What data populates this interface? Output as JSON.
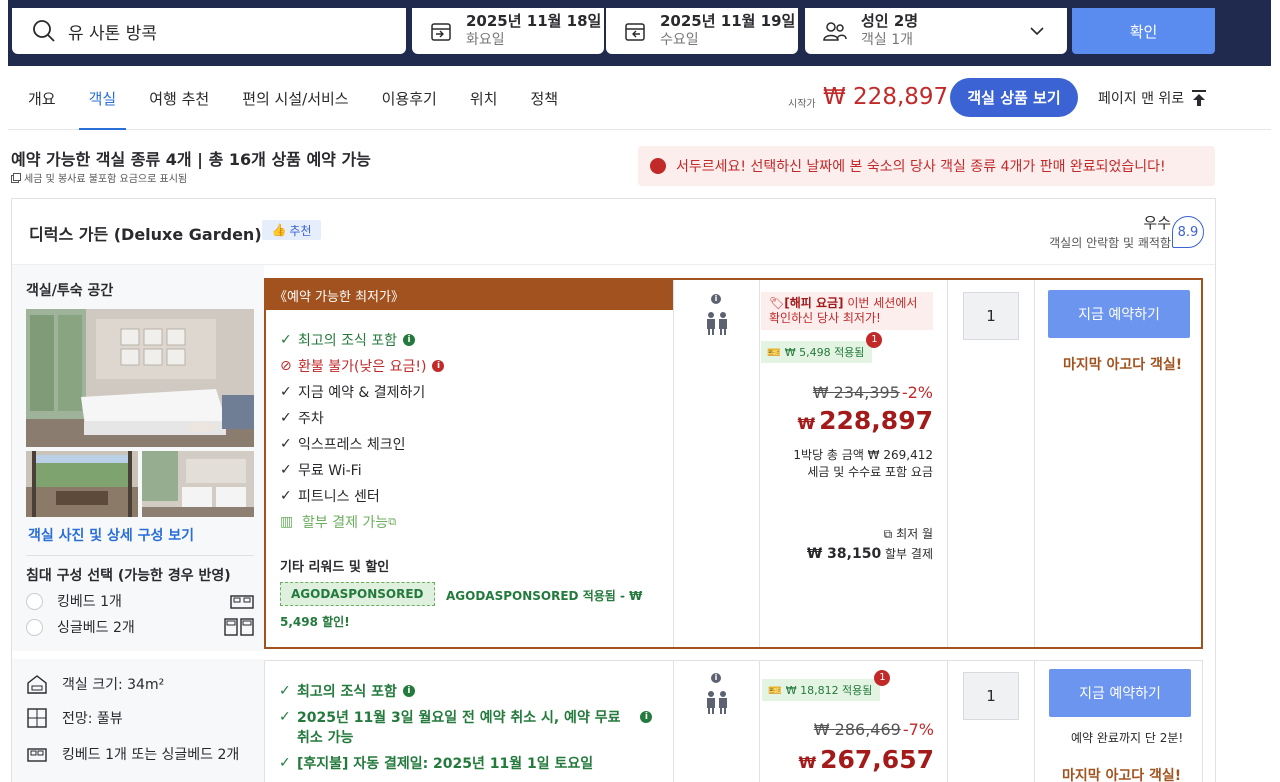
{
  "search": {
    "destination": "유 사톤 방콕",
    "checkin_date": "2025년 11월 18일",
    "checkin_day": "화요일",
    "checkout_date": "2025년 11월 19일",
    "checkout_day": "수요일",
    "guests": "성인 2명",
    "rooms": "객실 1개",
    "confirm_label": "확인"
  },
  "nav": {
    "tabs": [
      "개요",
      "객실",
      "여행 추천",
      "편의 시설/서비스",
      "이용후기",
      "위치",
      "정책"
    ],
    "active_tab": "객실",
    "start_label": "시작가",
    "start_price": "₩ 228,897",
    "rooms_button": "객실 상품 보기",
    "to_top": "페이지 맨 위로"
  },
  "summary": {
    "title": "예약 가능한 객실 종류 4개 | 총 16개 상품 예약 가능",
    "tax_note": "세금 및 봉사료 불포함 요금으로 표시됨",
    "alert": "서두르세요! 선택하신 날짜에 본 숙소의 당사 객실 종류 4개가 판매 완료되었습니다!"
  },
  "room": {
    "title": "디럭스 가든 (Deluxe Garden)",
    "recommend_badge": "추천",
    "rating_word": "우수",
    "rating_sub": "객실의 안락함 및 쾌적함",
    "rating_score": "8.9",
    "left": {
      "title": "객실/투숙 공간",
      "photo_link": "객실 사진 및 상세 구성 보기",
      "bed_title": "침대 구성 선택 (가능한 경우 반영)",
      "bed_options": [
        "킹베드 1개",
        "싱글베드 2개"
      ],
      "size": "객실 크기: 34m²",
      "view": "전망: 풀뷰",
      "beds": "킹베드 1개 또는 싱글베드 2개"
    }
  },
  "rate1": {
    "band": "《예약 가능한 최저가》",
    "features": [
      {
        "text": "최고의 조식 포함",
        "mark": "✓"
      },
      {
        "text": "환불 불가(낮은 요금!)",
        "mark": "⊘"
      },
      {
        "text": "지금 예약 & 결제하기",
        "mark": "✓"
      },
      {
        "text": "주차",
        "mark": "✓"
      },
      {
        "text": "익스프레스 체크인",
        "mark": "✓"
      },
      {
        "text": "무료 Wi-Fi",
        "mark": "✓"
      },
      {
        "text": "피트니스 센터",
        "mark": "✓"
      },
      {
        "text": "할부 결제 가능",
        "mark": ""
      }
    ],
    "rewards_title": "기타 리워드 및 할인",
    "coupon_code": "AGODASPONSORED",
    "coupon_applied_1": "AGODASPONSORED 적용됨 - ₩",
    "coupon_applied_2": "5,498 할인!",
    "happy_title": "[해피 요금]",
    "happy_text": " 이번 세션에서 확인하신 당사 최저가!",
    "promo": "₩ 5,498 적용됨",
    "promo_count": "1",
    "old_price": "₩ 234,395",
    "discount": "-2%",
    "price_won": "₩",
    "price": "228,897",
    "total_line": "1박당 총 금액 ₩ 269,412",
    "tax_line": "세금 및 수수료 포함 요금",
    "monthly_label": "최저 월",
    "monthly_price": "₩ 38,150",
    "monthly_suffix": " 할부 결제",
    "qty": "1",
    "book": "지금 예약하기",
    "last_room": "마지막 아고다 객실!"
  },
  "rate2": {
    "features": [
      {
        "text": "최고의 조식 포함",
        "mark": "✓"
      },
      {
        "text": "2025년 11월 3일 월요일 전 예약 취소 시, 예약 무료",
        "mark": "✓"
      },
      {
        "text": "취소 가능",
        "mark": ""
      },
      {
        "text": "[후지불] 자동 결제일: 2025년 11월 1일 토요일",
        "mark": "✓"
      }
    ],
    "promo": "₩ 18,812 적용됨",
    "promo_count": "1",
    "old_price": "₩ 286,469",
    "discount": "-7%",
    "price_won": "₩",
    "price": "267,657",
    "qty": "1",
    "book": "지금 예약하기",
    "note": "예약 완료까지 단 2분!",
    "last_room": "마지막 아고다 객실!"
  },
  "colors": {
    "header": "#1f2a4e",
    "accent": "#3b63d3",
    "price_red": "#a21a1a",
    "green": "#247a3c",
    "rate_border": "#a2521f"
  }
}
